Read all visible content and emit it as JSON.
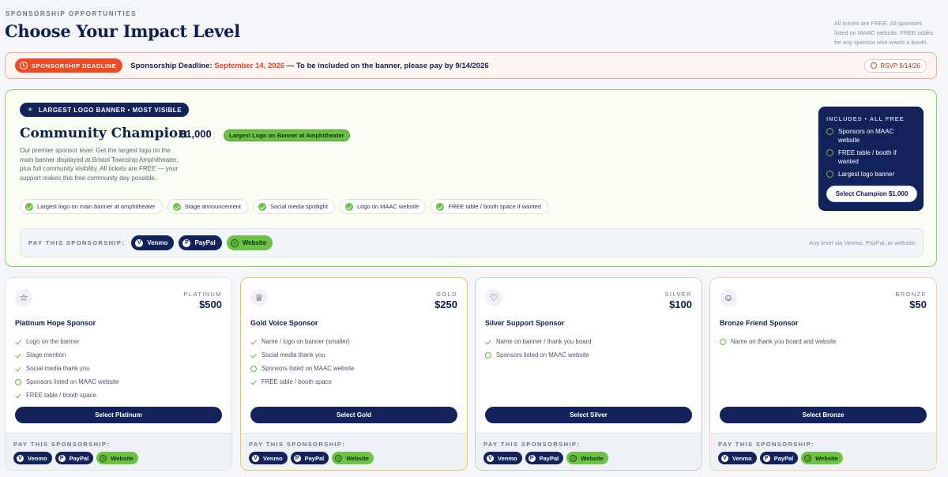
{
  "header": {
    "eyebrow": "SPONSORSHIP OPPORTUNITIES",
    "title": "Choose Your Impact Level",
    "side_note": "All tickets are FREE. All sponsors listed on MAAC website. FREE tables for any sponsor who wants a booth."
  },
  "deadline": {
    "badge": "SPONSORSHIP DEADLINE",
    "label": "Sponsorship Deadline:",
    "date": "September 14, 2026",
    "rest": "— To be included on the banner, please pay by 9/14/2026",
    "rsvp": "RSVP 9/14/26"
  },
  "champion": {
    "badge": "LARGEST LOGO BANNER • MOST VISIBLE",
    "title": "Community Champion",
    "price": "$1,000",
    "tag": "Largest Logo on Banner at Amphitheater",
    "description": "Our premier sponsor level. Get the largest logo on the main banner displayed at Bristol Township Amphitheater, plus full community visibility. All tickets are FREE — your support makes this free community day possible.",
    "chips": [
      "Largest logo on main banner at amphitheater",
      "Stage announcement",
      "Social media spotlight",
      "Logo on MAAC website",
      "FREE table / booth space if wanted"
    ],
    "pay_label": "PAY THIS SPONSORSHIP:",
    "pay_note": "Any level via Venmo, PayPal, or website",
    "includes": {
      "heading": "INCLUDES • ALL FREE",
      "items": [
        "Sponsors on MAAC website",
        "FREE table / booth if wanted",
        "Largest logo banner"
      ],
      "button": "Select Champion $1,000"
    }
  },
  "payments": {
    "venmo": "Venmo",
    "paypal": "PayPal",
    "website": "Website",
    "label": "PAY THIS SPONSORSHIP:"
  },
  "tiers": [
    {
      "level": "PLATINUM",
      "price": "$500",
      "name": "Platinum Hope Sponsor",
      "icon": "star-icon",
      "button": "Select Platinum",
      "features": [
        {
          "text": "Logo on the banner",
          "icon": "check"
        },
        {
          "text": "Stage mention",
          "icon": "check"
        },
        {
          "text": "Social media thank you",
          "icon": "check"
        },
        {
          "text": "Sponsors listed on MAAC website",
          "icon": "globe"
        },
        {
          "text": "FREE table / booth space",
          "icon": "check"
        }
      ]
    },
    {
      "level": "GOLD",
      "price": "$250",
      "name": "Gold Voice Sponsor",
      "icon": "award-icon",
      "button": "Select Gold",
      "features": [
        {
          "text": "Name / logo on banner (smaller)",
          "icon": "check"
        },
        {
          "text": "Social media thank you",
          "icon": "check"
        },
        {
          "text": "Sponsors listed on MAAC website",
          "icon": "globe"
        },
        {
          "text": "FREE table / booth space",
          "icon": "check"
        }
      ]
    },
    {
      "level": "SILVER",
      "price": "$100",
      "name": "Silver Support Sponsor",
      "icon": "heart-icon",
      "button": "Select Silver",
      "features": [
        {
          "text": "Name on banner / thank you board",
          "icon": "check"
        },
        {
          "text": "Sponsors listed on MAAC website",
          "icon": "globe"
        }
      ]
    },
    {
      "level": "BRONZE",
      "price": "$50",
      "name": "Bronze Friend Sponsor",
      "icon": "users-icon",
      "button": "Select Bronze",
      "features": [
        {
          "text": "Name on thank you board and website",
          "icon": "globe"
        }
      ]
    }
  ],
  "colors": {
    "navy": "#13225a",
    "green": "#6cc243",
    "red": "#ec4c26",
    "gold": "#f2c648"
  }
}
